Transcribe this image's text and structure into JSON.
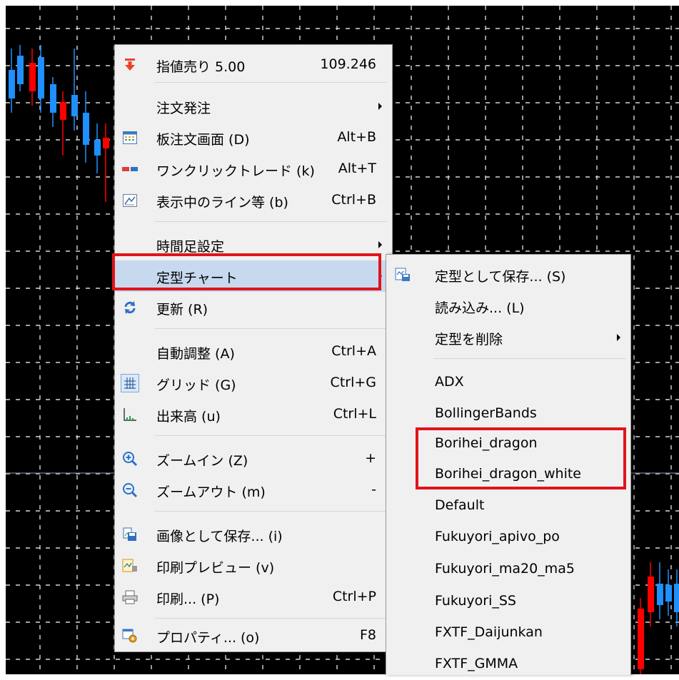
{
  "context_menu": {
    "sell_limit": {
      "label": "指値売り 5.00",
      "price": "109.246"
    },
    "order": {
      "label": "注文発注"
    },
    "board_order": {
      "label": "板注文画面 (D)",
      "shortcut": "Alt+B"
    },
    "one_click": {
      "label": "ワンクリックトレード (k)",
      "shortcut": "Alt+T"
    },
    "shown_lines": {
      "label": "表示中のライン等 (b)",
      "shortcut": "Ctrl+B"
    },
    "timeframe": {
      "label": "時間足設定"
    },
    "template_chart": {
      "label": "定型チャート"
    },
    "refresh": {
      "label": "更新 (R)"
    },
    "auto_scroll": {
      "label": "自動調整 (A)",
      "shortcut": "Ctrl+A"
    },
    "grid": {
      "label": "グリッド (G)",
      "shortcut": "Ctrl+G"
    },
    "volume": {
      "label": "出来高 (u)",
      "shortcut": "Ctrl+L"
    },
    "zoom_in": {
      "label": "ズームイン (Z)",
      "shortcut": "+"
    },
    "zoom_out": {
      "label": "ズームアウト (m)",
      "shortcut": "-"
    },
    "save_image": {
      "label": "画像として保存... (i)"
    },
    "print_preview": {
      "label": "印刷プレビュー (v)"
    },
    "print": {
      "label": "印刷... (P)",
      "shortcut": "Ctrl+P"
    },
    "properties": {
      "label": "プロパティ... (o)",
      "shortcut": "F8"
    }
  },
  "template_submenu": {
    "save_template": "定型として保存... (S)",
    "load": "読み込み... (L)",
    "delete_template": "定型を削除",
    "templates": [
      "ADX",
      "BollingerBands",
      "Borihei_dragon",
      "Borihei_dragon_white",
      "Default",
      "Fukuyori_apivo_po",
      "Fukuyori_ma20_ma5",
      "Fukuyori_SS",
      "FXTF_Daijunkan",
      "FXTF_GMMA"
    ]
  },
  "colors": {
    "chart_bg": "#000000",
    "grid": "#d8d8d8",
    "bull_candle": "#1e90ff",
    "bear_candle": "#ff0000",
    "menu_bg": "#f0f0f0",
    "hover_bg": "#c7d9ee",
    "highlight_border": "#e0141b"
  }
}
